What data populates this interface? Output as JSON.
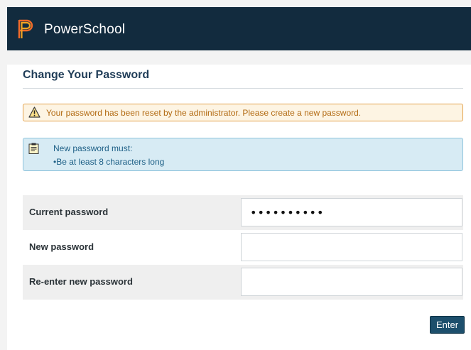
{
  "header": {
    "brand": "PowerSchool",
    "logo_icon": "powerschool-logo",
    "background_color": "#122b3e"
  },
  "page": {
    "title": "Change Your Password"
  },
  "warning": {
    "icon": "warning-triangle-icon",
    "text": "Your password has been reset by the administrator. Please create a new password."
  },
  "info": {
    "icon": "clipboard-note-icon",
    "line1": "New password must:",
    "line2": "•Be at least 8 characters long"
  },
  "form": {
    "rows": [
      {
        "label": "Current password",
        "value": "••••••••••"
      },
      {
        "label": "New password",
        "value": ""
      },
      {
        "label": "Re-enter new password",
        "value": ""
      }
    ]
  },
  "actions": {
    "enter_label": "Enter",
    "accent": "#1d4f6c"
  }
}
